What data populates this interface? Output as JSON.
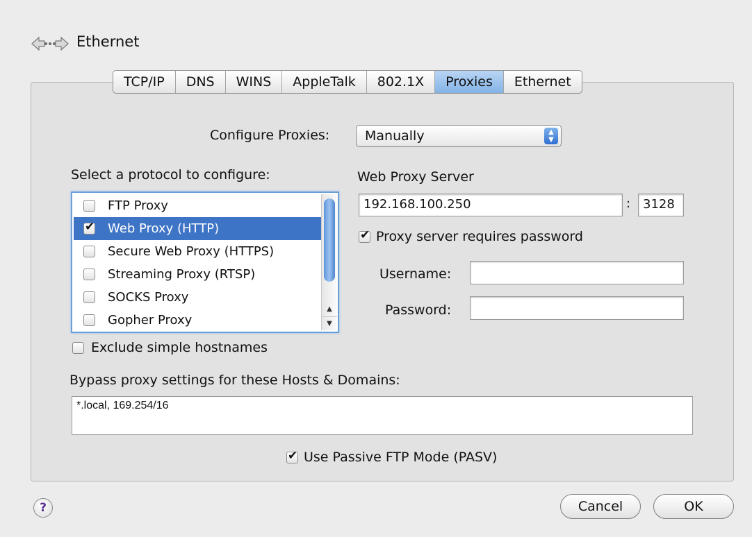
{
  "header": {
    "title": "Ethernet",
    "icon": "network-arrows-icon"
  },
  "tabs": [
    {
      "label": "TCP/IP",
      "selected": false
    },
    {
      "label": "DNS",
      "selected": false
    },
    {
      "label": "WINS",
      "selected": false
    },
    {
      "label": "AppleTalk",
      "selected": false
    },
    {
      "label": "802.1X",
      "selected": false
    },
    {
      "label": "Proxies",
      "selected": true
    },
    {
      "label": "Ethernet",
      "selected": false
    }
  ],
  "configure": {
    "label": "Configure Proxies:",
    "value": "Manually"
  },
  "protocols": {
    "label": "Select a protocol to configure:",
    "items": [
      {
        "label": "FTP Proxy",
        "checked": false,
        "selected": false
      },
      {
        "label": "Web Proxy (HTTP)",
        "checked": true,
        "selected": true
      },
      {
        "label": "Secure Web Proxy (HTTPS)",
        "checked": false,
        "selected": false
      },
      {
        "label": "Streaming Proxy (RTSP)",
        "checked": false,
        "selected": false
      },
      {
        "label": "SOCKS Proxy",
        "checked": false,
        "selected": false
      },
      {
        "label": "Gopher Proxy",
        "checked": false,
        "selected": false
      }
    ]
  },
  "exclude_simple": {
    "label": "Exclude simple hostnames",
    "checked": false
  },
  "web_proxy": {
    "heading": "Web Proxy Server",
    "server": "192.168.100.250",
    "colon": ":",
    "port": "3128",
    "requires_password": {
      "label": "Proxy server requires password",
      "checked": true
    },
    "username_label": "Username:",
    "username": "",
    "password_label": "Password:",
    "password": ""
  },
  "bypass": {
    "label": "Bypass proxy settings for these Hosts & Domains:",
    "value": "*.local, 169.254/16"
  },
  "pasv": {
    "label": "Use Passive FTP Mode (PASV)",
    "checked": true
  },
  "buttons": {
    "help": "?",
    "cancel": "Cancel",
    "ok": "OK"
  },
  "colors": {
    "accent": "#3e74c6",
    "tab_selected": "#83b3e6",
    "help_glyph": "#5b2d8e"
  }
}
